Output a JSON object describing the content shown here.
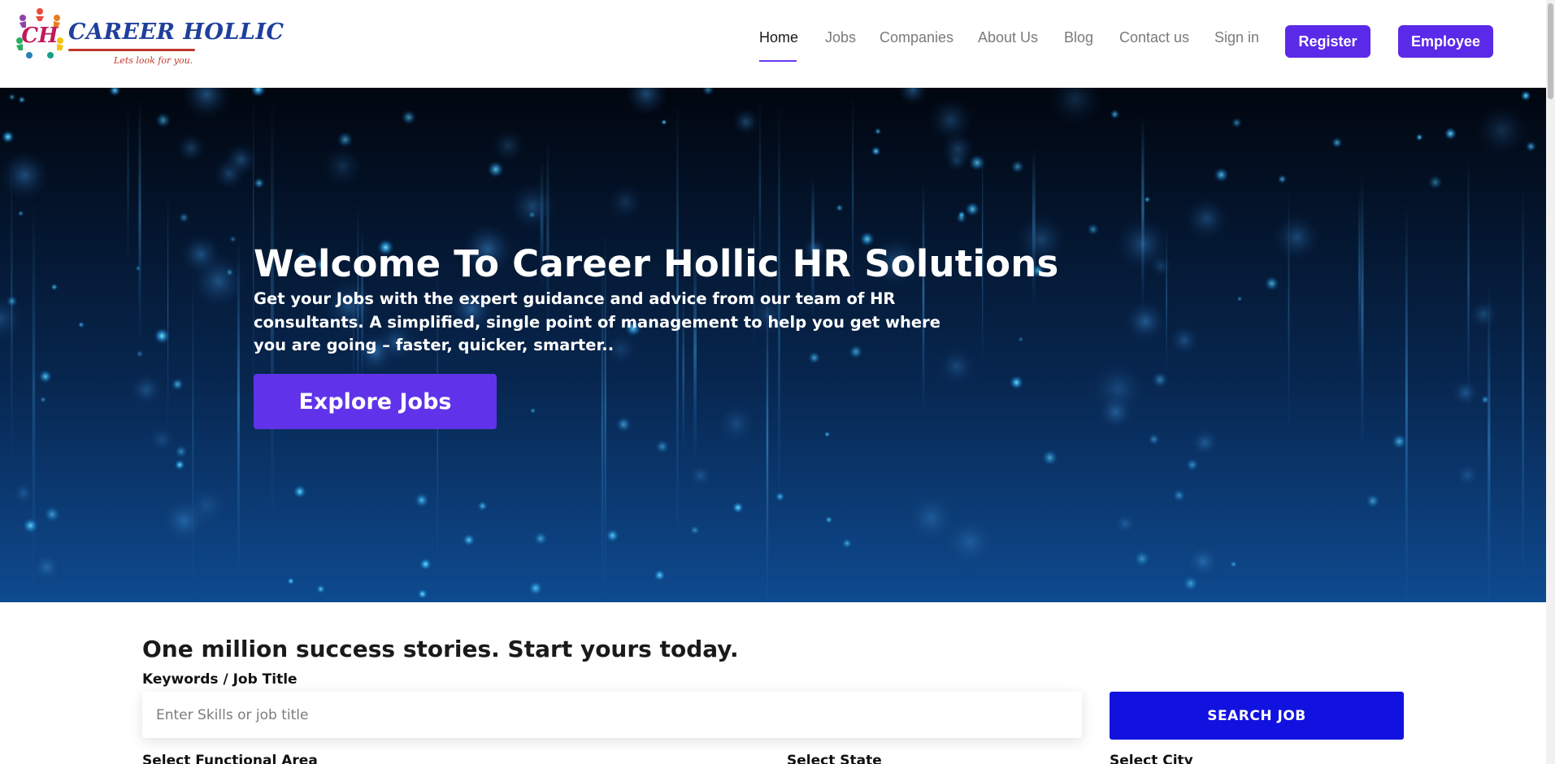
{
  "brand": {
    "logo_text": "CAREER HOLLIC",
    "tagline": "Lets look for you.",
    "logo_initials": "CH"
  },
  "nav": {
    "home": "Home",
    "jobs": "Jobs",
    "companies": "Companies",
    "about": "About Us",
    "blog": "Blog",
    "contact": "Contact us",
    "signin": "Sign in",
    "register": "Register",
    "employee": "Employee",
    "active": "Home"
  },
  "hero": {
    "title": "Welcome To Career Hollic HR Solutions",
    "subtitle": "Get your Jobs with the expert guidance and advice from our team of HR consultants. A simplified, single point of management to help you get where you are going – faster, quicker, smarter..",
    "cta": "Explore Jobs"
  },
  "search": {
    "heading": "One million success stories. Start yours today.",
    "keywords_label": "Keywords / Job Title",
    "keywords_placeholder": "Enter Skills or job title",
    "button": "SEARCH JOB",
    "functional_area_label": "Select Functional Area",
    "state_label": "Select State",
    "city_label": "Select City"
  },
  "colors": {
    "primary": "#5b29e8",
    "search_button": "#1212e0",
    "hero_bg": "#020a18"
  },
  "icons": {
    "logo": "career-hollic-logo"
  }
}
